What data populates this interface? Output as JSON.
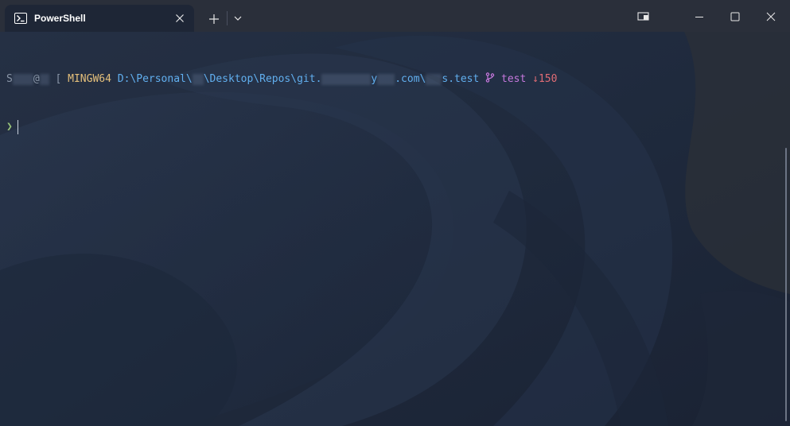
{
  "tab": {
    "title": "PowerShell",
    "icon": "powershell-icon"
  },
  "titlebar": {
    "new_tab_icon": "plus-icon",
    "dropdown_icon": "chevron-down-icon",
    "window_buttons": [
      "compact-overlay-icon",
      "minimize-icon",
      "maximize-icon",
      "close-icon"
    ]
  },
  "terminal": {
    "line1": {
      "user_start": "S",
      "at": "@",
      "host_start": "[",
      "env": "MINGW64",
      "path_part1": "D:\\Personal\\",
      "path_part2": "\\Desktop\\Repos\\git.",
      "path_part3": "y",
      "path_part4": ".com\\",
      "path_part5": "s.test",
      "branch_icon": "git-branch-icon",
      "branch": "test",
      "behind": "↓150"
    },
    "line2": {
      "prompt": "❯"
    }
  },
  "colors": {
    "titlebar": "#2a2f3a",
    "tab": "#1e2636",
    "background": "#202a3a",
    "env": "#e5c07b",
    "path": "#61afef",
    "branch": "#c678dd",
    "behind": "#e06c75",
    "prompt": "#98c379"
  }
}
